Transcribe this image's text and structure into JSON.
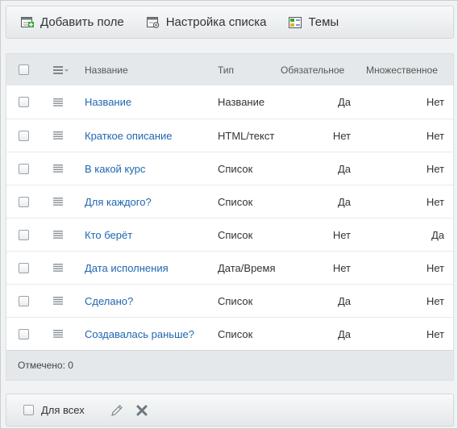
{
  "toolbar": {
    "add_field": "Добавить поле",
    "list_settings": "Настройка списка",
    "themes": "Темы"
  },
  "columns": {
    "name": "Название",
    "type": "Тип",
    "required": "Обязательное",
    "multiple": "Множественное"
  },
  "rows": [
    {
      "name": "Название",
      "type": "Название",
      "required": "Да",
      "multiple": "Нет"
    },
    {
      "name": "Краткое описание",
      "type": "HTML/текст",
      "required": "Нет",
      "multiple": "Нет"
    },
    {
      "name": "В какой курс",
      "type": "Список",
      "required": "Да",
      "multiple": "Нет"
    },
    {
      "name": "Для каждого?",
      "type": "Список",
      "required": "Да",
      "multiple": "Нет"
    },
    {
      "name": "Кто берёт",
      "type": "Список",
      "required": "Нет",
      "multiple": "Да"
    },
    {
      "name": "Дата исполнения",
      "type": "Дата/Время",
      "required": "Нет",
      "multiple": "Нет"
    },
    {
      "name": "Сделано?",
      "type": "Список",
      "required": "Да",
      "multiple": "Нет"
    },
    {
      "name": "Создавалась раньше?",
      "type": "Список",
      "required": "Да",
      "multiple": "Нет"
    }
  ],
  "footer": {
    "selected": "Отмечено: 0"
  },
  "actions": {
    "for_all": "Для всех"
  },
  "icons": {
    "add_field": "add-field-icon",
    "list_settings": "list-settings-icon",
    "themes": "themes-icon",
    "menu": "menu-lines-icon",
    "drag": "drag-handle-icon",
    "edit": "pencil-icon",
    "delete": "delete-x-icon"
  },
  "colors": {
    "link": "#2067b0",
    "header_bg": "#e4e8ea"
  }
}
